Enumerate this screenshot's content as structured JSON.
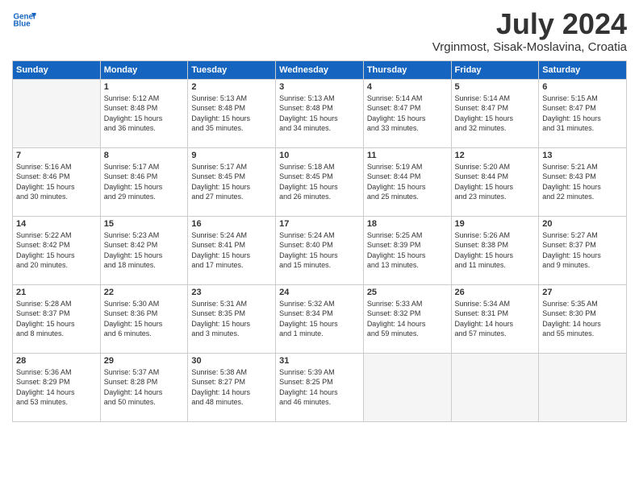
{
  "logo": {
    "line1": "General",
    "line2": "Blue"
  },
  "title": "July 2024",
  "location": "Vrginmost, Sisak-Moslavina, Croatia",
  "headers": [
    "Sunday",
    "Monday",
    "Tuesday",
    "Wednesday",
    "Thursday",
    "Friday",
    "Saturday"
  ],
  "weeks": [
    [
      {
        "day": "",
        "info": ""
      },
      {
        "day": "1",
        "info": "Sunrise: 5:12 AM\nSunset: 8:48 PM\nDaylight: 15 hours\nand 36 minutes."
      },
      {
        "day": "2",
        "info": "Sunrise: 5:13 AM\nSunset: 8:48 PM\nDaylight: 15 hours\nand 35 minutes."
      },
      {
        "day": "3",
        "info": "Sunrise: 5:13 AM\nSunset: 8:48 PM\nDaylight: 15 hours\nand 34 minutes."
      },
      {
        "day": "4",
        "info": "Sunrise: 5:14 AM\nSunset: 8:47 PM\nDaylight: 15 hours\nand 33 minutes."
      },
      {
        "day": "5",
        "info": "Sunrise: 5:14 AM\nSunset: 8:47 PM\nDaylight: 15 hours\nand 32 minutes."
      },
      {
        "day": "6",
        "info": "Sunrise: 5:15 AM\nSunset: 8:47 PM\nDaylight: 15 hours\nand 31 minutes."
      }
    ],
    [
      {
        "day": "7",
        "info": "Sunrise: 5:16 AM\nSunset: 8:46 PM\nDaylight: 15 hours\nand 30 minutes."
      },
      {
        "day": "8",
        "info": "Sunrise: 5:17 AM\nSunset: 8:46 PM\nDaylight: 15 hours\nand 29 minutes."
      },
      {
        "day": "9",
        "info": "Sunrise: 5:17 AM\nSunset: 8:45 PM\nDaylight: 15 hours\nand 27 minutes."
      },
      {
        "day": "10",
        "info": "Sunrise: 5:18 AM\nSunset: 8:45 PM\nDaylight: 15 hours\nand 26 minutes."
      },
      {
        "day": "11",
        "info": "Sunrise: 5:19 AM\nSunset: 8:44 PM\nDaylight: 15 hours\nand 25 minutes."
      },
      {
        "day": "12",
        "info": "Sunrise: 5:20 AM\nSunset: 8:44 PM\nDaylight: 15 hours\nand 23 minutes."
      },
      {
        "day": "13",
        "info": "Sunrise: 5:21 AM\nSunset: 8:43 PM\nDaylight: 15 hours\nand 22 minutes."
      }
    ],
    [
      {
        "day": "14",
        "info": "Sunrise: 5:22 AM\nSunset: 8:42 PM\nDaylight: 15 hours\nand 20 minutes."
      },
      {
        "day": "15",
        "info": "Sunrise: 5:23 AM\nSunset: 8:42 PM\nDaylight: 15 hours\nand 18 minutes."
      },
      {
        "day": "16",
        "info": "Sunrise: 5:24 AM\nSunset: 8:41 PM\nDaylight: 15 hours\nand 17 minutes."
      },
      {
        "day": "17",
        "info": "Sunrise: 5:24 AM\nSunset: 8:40 PM\nDaylight: 15 hours\nand 15 minutes."
      },
      {
        "day": "18",
        "info": "Sunrise: 5:25 AM\nSunset: 8:39 PM\nDaylight: 15 hours\nand 13 minutes."
      },
      {
        "day": "19",
        "info": "Sunrise: 5:26 AM\nSunset: 8:38 PM\nDaylight: 15 hours\nand 11 minutes."
      },
      {
        "day": "20",
        "info": "Sunrise: 5:27 AM\nSunset: 8:37 PM\nDaylight: 15 hours\nand 9 minutes."
      }
    ],
    [
      {
        "day": "21",
        "info": "Sunrise: 5:28 AM\nSunset: 8:37 PM\nDaylight: 15 hours\nand 8 minutes."
      },
      {
        "day": "22",
        "info": "Sunrise: 5:30 AM\nSunset: 8:36 PM\nDaylight: 15 hours\nand 6 minutes."
      },
      {
        "day": "23",
        "info": "Sunrise: 5:31 AM\nSunset: 8:35 PM\nDaylight: 15 hours\nand 3 minutes."
      },
      {
        "day": "24",
        "info": "Sunrise: 5:32 AM\nSunset: 8:34 PM\nDaylight: 15 hours\nand 1 minute."
      },
      {
        "day": "25",
        "info": "Sunrise: 5:33 AM\nSunset: 8:32 PM\nDaylight: 14 hours\nand 59 minutes."
      },
      {
        "day": "26",
        "info": "Sunrise: 5:34 AM\nSunset: 8:31 PM\nDaylight: 14 hours\nand 57 minutes."
      },
      {
        "day": "27",
        "info": "Sunrise: 5:35 AM\nSunset: 8:30 PM\nDaylight: 14 hours\nand 55 minutes."
      }
    ],
    [
      {
        "day": "28",
        "info": "Sunrise: 5:36 AM\nSunset: 8:29 PM\nDaylight: 14 hours\nand 53 minutes."
      },
      {
        "day": "29",
        "info": "Sunrise: 5:37 AM\nSunset: 8:28 PM\nDaylight: 14 hours\nand 50 minutes."
      },
      {
        "day": "30",
        "info": "Sunrise: 5:38 AM\nSunset: 8:27 PM\nDaylight: 14 hours\nand 48 minutes."
      },
      {
        "day": "31",
        "info": "Sunrise: 5:39 AM\nSunset: 8:25 PM\nDaylight: 14 hours\nand 46 minutes."
      },
      {
        "day": "",
        "info": ""
      },
      {
        "day": "",
        "info": ""
      },
      {
        "day": "",
        "info": ""
      }
    ]
  ]
}
